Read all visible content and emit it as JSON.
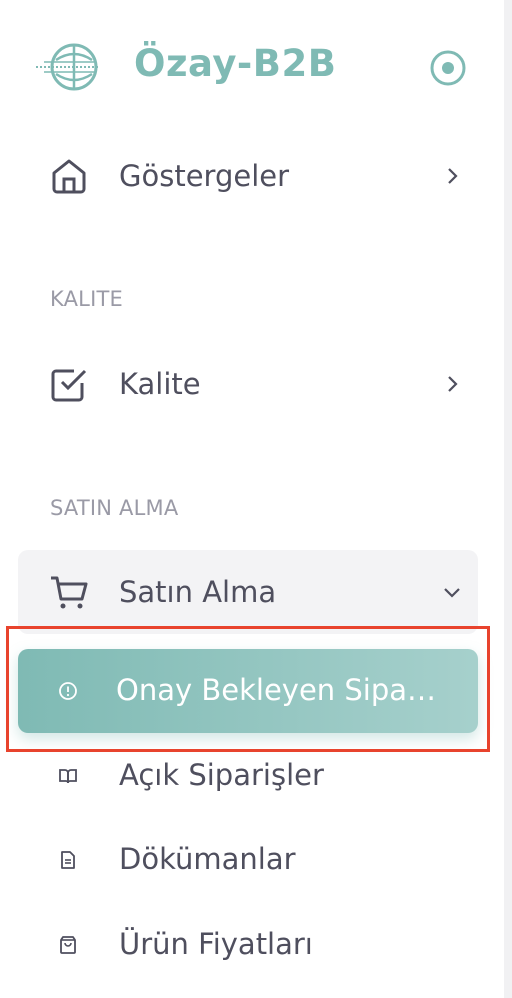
{
  "brand": {
    "name": "Özay-B2B"
  },
  "menu": {
    "dashboard": {
      "label": "Göstergeler"
    },
    "quality_header": "KALITE",
    "quality": {
      "label": "Kalite"
    },
    "purchase_header": "SATIN ALMA",
    "purchase": {
      "label": "Satın Alma",
      "children": [
        {
          "label": "Onay Bekleyen Sipa…",
          "icon": "alert-circle-icon",
          "active": true
        },
        {
          "label": "Açık Siparişler",
          "icon": "book-open-icon"
        },
        {
          "label": "Dökümanlar",
          "icon": "document-icon"
        },
        {
          "label": "Ürün Fiyatları",
          "icon": "shopping-bag-icon"
        }
      ]
    }
  },
  "colors": {
    "accent": "#7fbab4",
    "highlight": "#e8432d",
    "text": "#4f4f5e",
    "section": "#9a9aa6"
  }
}
